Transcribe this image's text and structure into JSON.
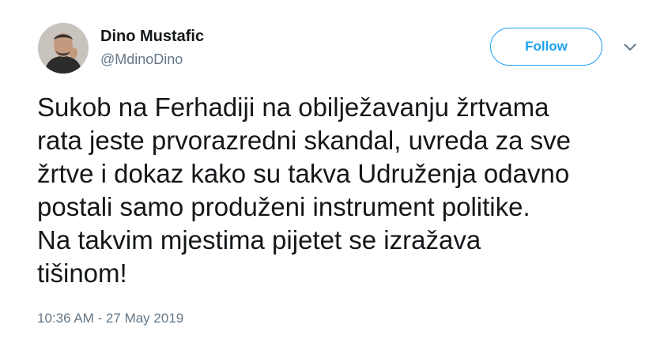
{
  "tweet": {
    "author": {
      "display_name": "Dino Mustafic",
      "handle": "@MdinoDino",
      "avatar_icon": "user-photo"
    },
    "follow_label": "Follow",
    "more_icon": "chevron-down-icon",
    "text_lines": [
      "Sukob na Ferhadiji na obilježavanju žrtvama",
      "rata jeste prvorazredni skandal, uvreda za sve",
      "žrtve i dokaz kako su takva Udruženja odavno",
      "postali samo produženi instrument politike.",
      "Na takvim mjestima pijetet se izražava",
      "tišinom!"
    ],
    "timestamp": "10:36 AM - 27 May 2019"
  },
  "colors": {
    "accent": "#1da1f2",
    "text_primary": "#14171a",
    "text_secondary": "#657786",
    "background": "#ffffff"
  }
}
